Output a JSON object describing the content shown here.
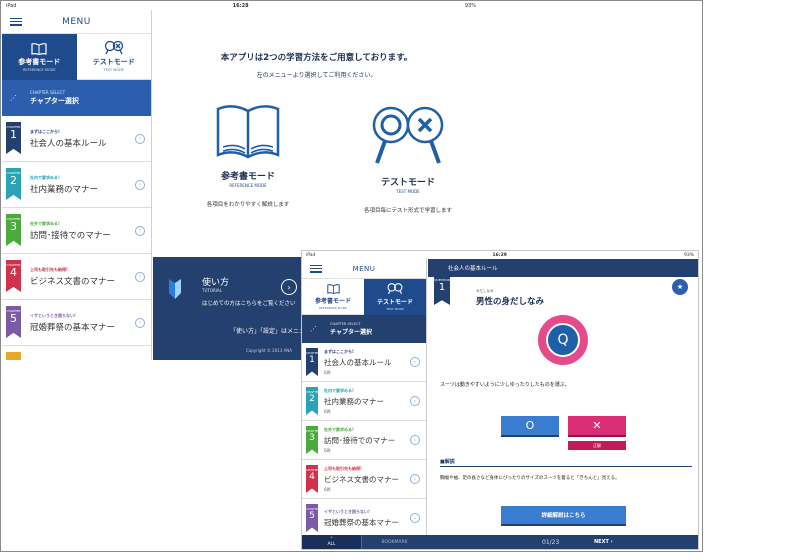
{
  "screen1": {
    "status": {
      "left": "iPad",
      "time": "16:28",
      "battery": "93%"
    },
    "menu_title": "MENU",
    "modes": [
      {
        "label": "参考書モード",
        "sub": "REFERENCE MODE"
      },
      {
        "label": "テストモード",
        "sub": "TEST MODE"
      }
    ],
    "chapter_select": {
      "sub": "CHAPTER SELECT",
      "title": "チャプター選択"
    },
    "chapter_word": "CHAPTER",
    "chapters": [
      {
        "num": "1",
        "tag": "まずはここから!",
        "name": "社会人の基本ルール",
        "color": "#24406e"
      },
      {
        "num": "2",
        "tag": "社内で要求める!",
        "name": "社内業務のマナー",
        "color": "#2aa3b5"
      },
      {
        "num": "3",
        "tag": "社外で要求める!",
        "name": "訪問･接待でのマナー",
        "color": "#4aab3c"
      },
      {
        "num": "4",
        "tag": "上司も取引先も納得!",
        "name": "ビジネス文書のマナー",
        "color": "#d0324b"
      },
      {
        "num": "5",
        "tag": "イザというとき困らない!",
        "name": "冠婚葬祭の基本マナー",
        "color": "#7b5ba6"
      }
    ],
    "content": {
      "title": "本アプリは2つの学習方法をご用意しております。",
      "subtitle": "左のメニューより選択してご利用ください。",
      "reference": {
        "name": "参考書モード",
        "tag": "REFERENCE MODE",
        "desc": "各項目をわかりやすく解説します"
      },
      "test": {
        "name": "テストモード",
        "tag": "TEST MODE",
        "desc": "各項目毎にテスト形式で学習します"
      }
    },
    "tutorial": {
      "title": "使い方",
      "sub": "TUTORIAL",
      "desc": "はじめての方はこちらをご覧ください",
      "note": "「使い方」「設定」はメニュ",
      "copyright": "Copyright © 2013 ANA"
    }
  },
  "screen2": {
    "status": {
      "left": "iPad",
      "time": "16:29",
      "battery": "93%"
    },
    "menu_title": "MENU",
    "modes": [
      {
        "label": "参考書モード",
        "sub": "REFERENCE MODE"
      },
      {
        "label": "テストモード",
        "sub": "TEST MODE"
      }
    ],
    "chapter_select": {
      "sub": "CHAPTER SELECT",
      "title": "チャプター選択"
    },
    "chapter_word": "CHAPTER",
    "chapters": [
      {
        "num": "1",
        "tag": "まずはここから!",
        "name": "社会人の基本ルール",
        "count": "6問",
        "color": "#24406e"
      },
      {
        "num": "2",
        "tag": "社内で要求める!",
        "name": "社内業務のマナー",
        "count": "6問",
        "color": "#2aa3b5"
      },
      {
        "num": "3",
        "tag": "社外で要求める!",
        "name": "訪問･接待でのマナー",
        "count": "6問",
        "color": "#4aab3c"
      },
      {
        "num": "4",
        "tag": "上司も取引先も納得!",
        "name": "ビジネス文書のマナー",
        "count": "6問",
        "color": "#d0324b"
      },
      {
        "num": "5",
        "tag": "イザというとき困らない!",
        "name": "冠婚葬祭の基本マナー",
        "count": "",
        "color": "#7b5ba6"
      }
    ],
    "question": {
      "header": "社会人の基本ルール",
      "qword": "QUESTION",
      "qnum": "1",
      "bookmark_label": "BOOKMARK",
      "ruby": "みだしなみ",
      "title": "男性の身だしなみ",
      "symbol": "Q",
      "text": "スーツは動きやすいように少しゆったりしたものを選ぶ。",
      "answer_o": "O",
      "answer_x": "✕",
      "correct_label": "正解",
      "exp_heading": "■解説",
      "exp_text": "胸幅や袖、足の長さなど身体にぴったりのサイズのスーツを着ると「きちんと」見える。",
      "detail_button": "詳細解説はこちら"
    },
    "bottom": {
      "all": "ALL",
      "bookmark": "BOOKMARK",
      "page": "01/23",
      "next": "NEXT"
    }
  }
}
